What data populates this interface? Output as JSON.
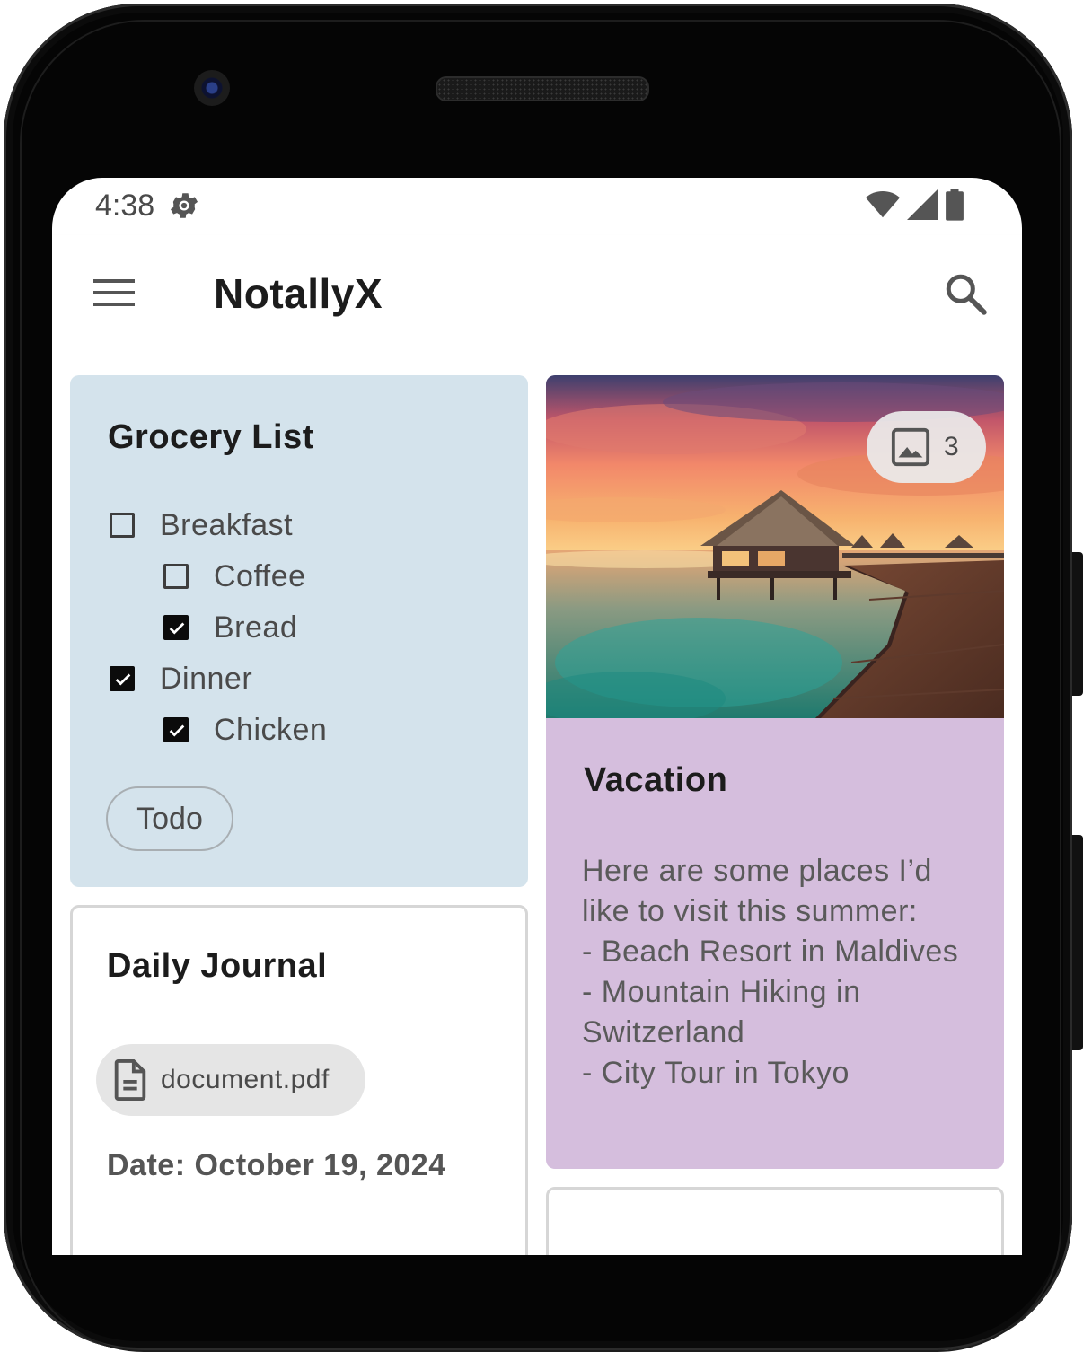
{
  "status_bar": {
    "time": "4:38",
    "icons": [
      "gear-icon",
      "wifi-icon",
      "signal-icon",
      "battery-icon"
    ]
  },
  "app_bar": {
    "title": "NotallyX",
    "menu_icon": "menu-icon",
    "search_icon": "search-icon"
  },
  "notes": {
    "grocery": {
      "title": "Grocery List",
      "items": [
        {
          "label": "Breakfast",
          "checked": false
        },
        {
          "label": "Coffee",
          "checked": false
        },
        {
          "label": "Bread",
          "checked": true
        },
        {
          "label": "Dinner",
          "checked": true
        },
        {
          "label": "Chicken",
          "checked": true
        }
      ],
      "label": "Todo"
    },
    "journal": {
      "title": "Daily Journal",
      "attachment": "document.pdf",
      "date": "Date: October 19, 2024"
    },
    "vacation": {
      "image_count": "3",
      "title": "Vacation",
      "body": "Here are some places I’d like to visit this summer:\n- Beach Resort in Maldives\n- Mountain Hiking in Switzerland\n- City Tour in Tokyo"
    }
  },
  "colors": {
    "grocery_card": "#d4e3ec",
    "vacation_card": "#d5bedd",
    "app_bar": "#ffffff"
  }
}
